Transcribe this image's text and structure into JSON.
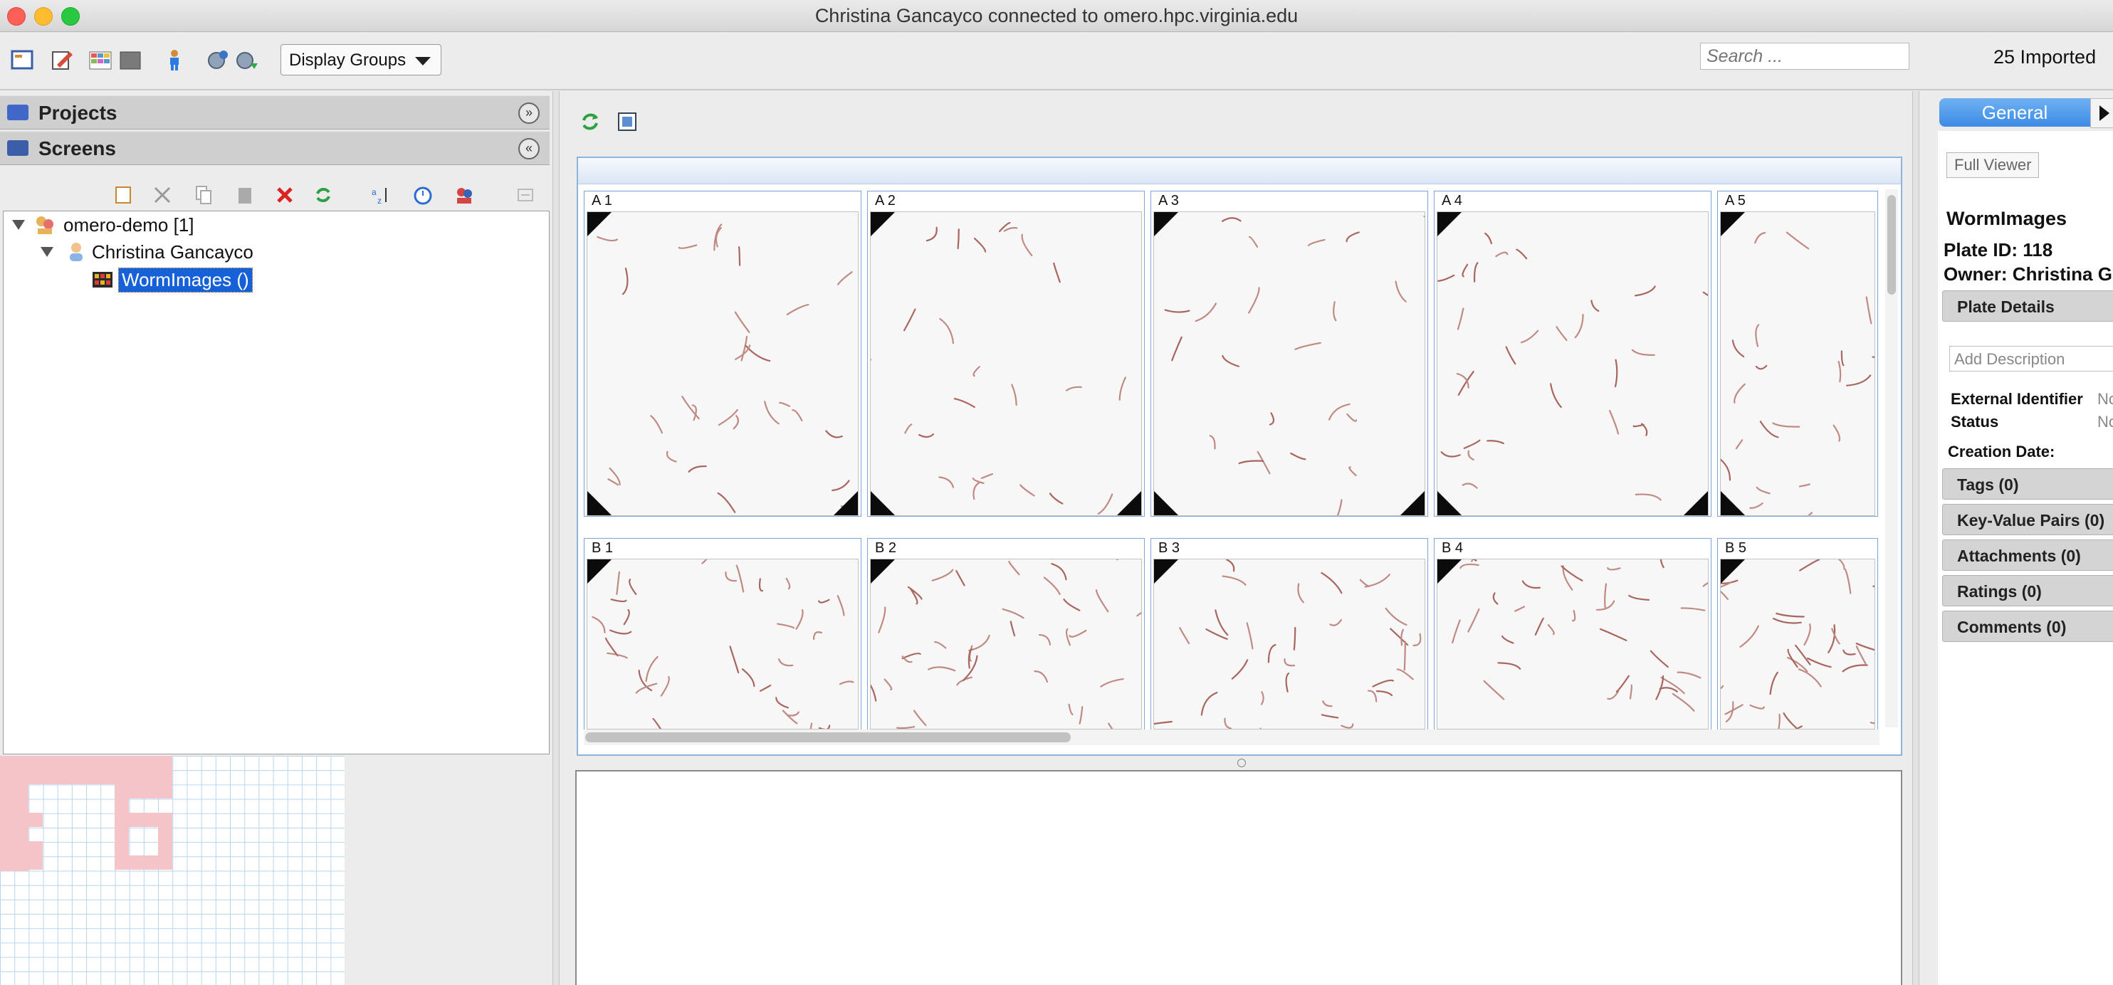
{
  "window": {
    "title": "Christina Gancayco connected to omero.hpc.virginia.edu"
  },
  "toolbar": {
    "display_groups": "Display Groups",
    "search_placeholder": "Search ...",
    "imported": "25 Imported",
    "icons": [
      "new-project-icon",
      "edit-icon",
      "table-view-icon",
      "gallery-icon",
      "user-icon",
      "group-import-icon",
      "import-icon",
      "chevron-down-icon"
    ]
  },
  "left_panel": {
    "projects_label": "Projects",
    "screens_label": "Screens",
    "tree": {
      "group": "omero-demo [1]",
      "user": "Christina Gancayco",
      "plate": "WormImages ()"
    },
    "colors": {
      "selection": "#1660d8",
      "well_filled": "#f5c4c8",
      "grid_line": "#b8d4ee"
    }
  },
  "plate": {
    "wells": [
      {
        "label": "A 1"
      },
      {
        "label": "A 2"
      },
      {
        "label": "A 3"
      },
      {
        "label": "A 4"
      },
      {
        "label": "A 5"
      },
      {
        "label": "B 1"
      },
      {
        "label": "B 2"
      },
      {
        "label": "B 3"
      },
      {
        "label": "B 4"
      },
      {
        "label": "B 5"
      }
    ]
  },
  "right_panel": {
    "tab_general": "General",
    "full_viewer": "Full Viewer",
    "name": "WormImages",
    "plate_id": "Plate ID: 118",
    "owner": "Owner: Christina G",
    "plate_details": "Plate Details",
    "add_description": "Add Description",
    "external_identifier_label": "External Identifier",
    "external_identifier_value": "No",
    "status_label": "Status",
    "status_value": "No",
    "creation_date_label": "Creation Date:",
    "sections": {
      "tags": "Tags (0)",
      "kv": "Key-Value Pairs (0)",
      "attachments": "Attachments (0)",
      "ratings": "Ratings (0)",
      "comments": "Comments (0)"
    },
    "colors": {
      "tab": "#3d8be6"
    }
  }
}
